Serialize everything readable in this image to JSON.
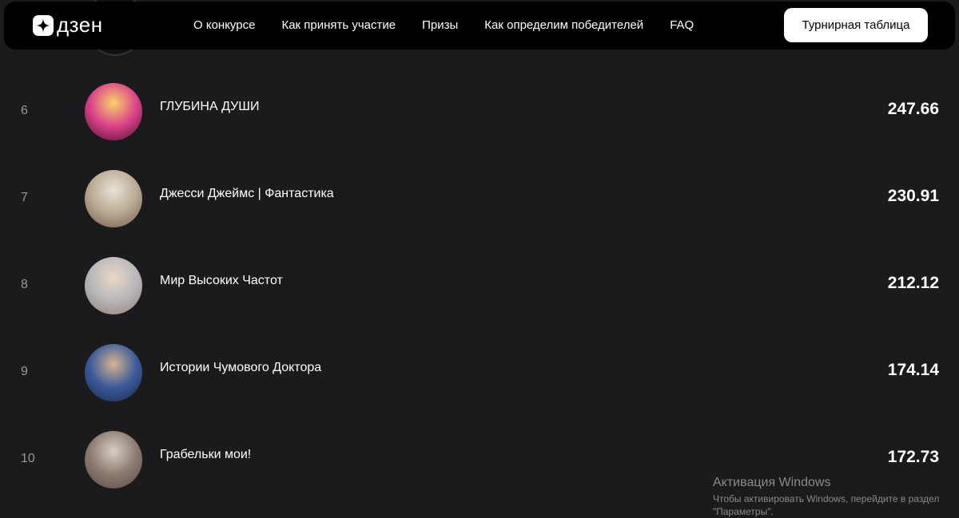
{
  "header": {
    "logo_text": "дзен",
    "nav": [
      "О конкурсе",
      "Как принять участие",
      "Призы",
      "Как определим победителей",
      "FAQ"
    ],
    "cta_label": "Турнирная таблица"
  },
  "leaderboard": [
    {
      "rank": "6",
      "name": "ГЛУБИНА ДУШИ",
      "score": "247.66",
      "avatar_colors": [
        "#f9d36a",
        "#d9418a",
        "#4a0f2a"
      ]
    },
    {
      "rank": "7",
      "name": "Джесси Джеймс | Фантастика",
      "score": "230.91",
      "avatar_colors": [
        "#e8e3d6",
        "#b9a992",
        "#6b5a48"
      ]
    },
    {
      "rank": "8",
      "name": "Мир Высоких Частот",
      "score": "212.12",
      "avatar_colors": [
        "#e9d8c8",
        "#b8b7ba",
        "#8e7f74"
      ]
    },
    {
      "rank": "9",
      "name": "Истории Чумового Доктора",
      "score": "174.14",
      "avatar_colors": [
        "#d8b48f",
        "#3a5a9a",
        "#1a2a4a"
      ]
    },
    {
      "rank": "10",
      "name": "Грабельки мои!",
      "score": "172.73",
      "avatar_colors": [
        "#d6cfc6",
        "#8b7a70",
        "#5a4a44"
      ]
    }
  ],
  "windows_notice": {
    "title": "Активация Windows",
    "subtitle": "Чтобы активировать Windows, перейдите в раздел \"Параметры\"."
  }
}
